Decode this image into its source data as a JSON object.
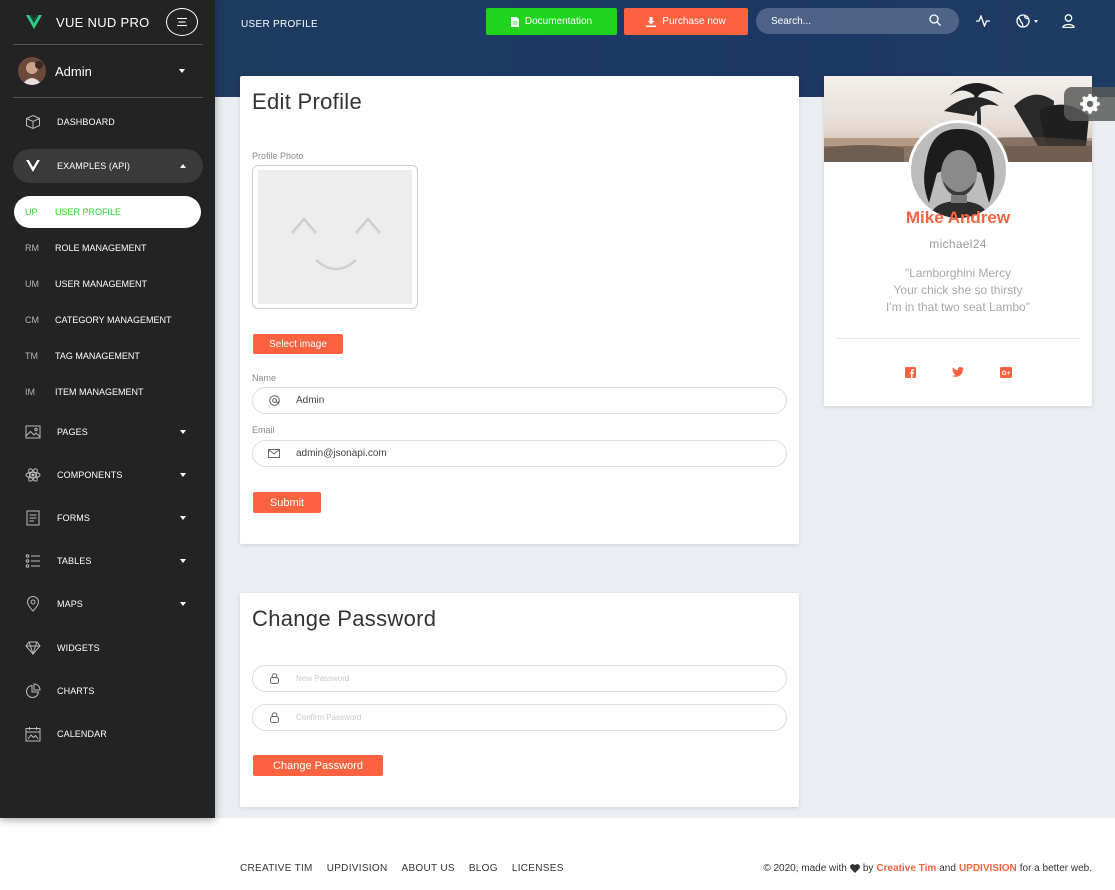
{
  "brand": {
    "name": "VUE NUD PRO"
  },
  "sidebar": {
    "user": "Admin",
    "items": [
      {
        "label": "DASHBOARD",
        "icon": "cube-icon"
      },
      {
        "label": "EXAMPLES (API)",
        "icon": "vue-logo-icon"
      },
      {
        "label": "PAGES",
        "icon": "image-icon"
      },
      {
        "label": "COMPONENTS",
        "icon": "atom-icon"
      },
      {
        "label": "FORMS",
        "icon": "form-icon"
      },
      {
        "label": "TABLES",
        "icon": "list-icon"
      },
      {
        "label": "MAPS",
        "icon": "map-pin-icon"
      },
      {
        "label": "WIDGETS",
        "icon": "diamond-icon"
      },
      {
        "label": "CHARTS",
        "icon": "pie-chart-icon"
      },
      {
        "label": "CALENDAR",
        "icon": "calendar-icon"
      }
    ],
    "sub_items": [
      {
        "abbr": "UP",
        "label": "USER PROFILE"
      },
      {
        "abbr": "RM",
        "label": "ROLE MANAGEMENT"
      },
      {
        "abbr": "UM",
        "label": "USER MANAGEMENT"
      },
      {
        "abbr": "CM",
        "label": "CATEGORY MANAGEMENT"
      },
      {
        "abbr": "TM",
        "label": "TAG MANAGEMENT"
      },
      {
        "abbr": "IM",
        "label": "ITEM MANAGEMENT"
      }
    ]
  },
  "navbar": {
    "title": "USER PROFILE",
    "doc_label": "Documentation",
    "buy_label": "Purchase now",
    "search_placeholder": "Search..."
  },
  "edit_profile": {
    "title": "Edit Profile",
    "photo_label": "Profile Photo",
    "select_image": "Select image",
    "name_label": "Name",
    "name_value": "Admin",
    "email_label": "Email",
    "email_value": "admin@jsonapi.com",
    "submit": "Submit"
  },
  "change_password": {
    "title": "Change Password",
    "new_placeholder": "New Password",
    "confirm_placeholder": "Confirm Password",
    "button": "Change Password"
  },
  "profile_card": {
    "name": "Mike Andrew",
    "username": "michael24",
    "quote": [
      "\"Lamborghini Mercy",
      "Your chick she so thirsty",
      "I'm in that two seat Lambo\""
    ]
  },
  "footer": {
    "links": [
      "CREATIVE TIM",
      "UPDIVISION",
      "ABOUT US",
      "BLOG",
      "LICENSES"
    ],
    "copy_prefix": "© 2020, made with",
    "copy_by": "by",
    "author1": "Creative Tim",
    "copy_and": "and",
    "author2": "UPDIVISION",
    "copy_suffix": "for a better web."
  },
  "colors": {
    "accent": "#fb6340",
    "success": "#1fd31f",
    "sidebar": "#232323",
    "header": "#1d3a63"
  }
}
